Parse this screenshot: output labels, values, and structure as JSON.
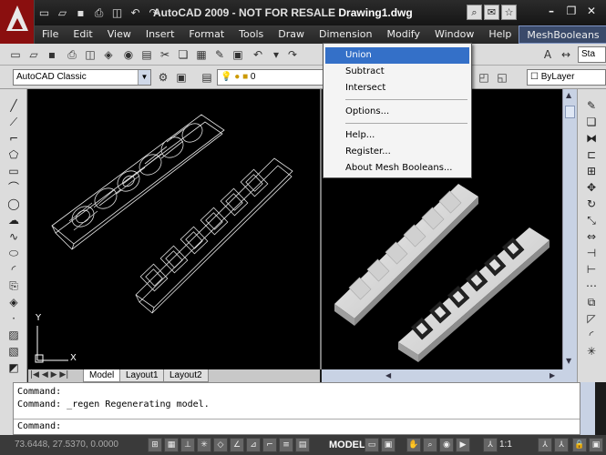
{
  "window": {
    "title_app": "AutoCAD 2009 - NOT FOR RESALE",
    "title_doc": "Drawing1.dwg"
  },
  "menubar": {
    "items": [
      "File",
      "Edit",
      "View",
      "Insert",
      "Format",
      "Tools",
      "Draw",
      "Dimension",
      "Modify",
      "Window",
      "Help",
      "MeshBooleans"
    ]
  },
  "workspace_combo": "AutoCAD Classic",
  "layer_combo": "0",
  "linetype_combo": "ByLayer",
  "dropdown": {
    "items": [
      "Union",
      "Subtract",
      "Intersect",
      "Options...",
      "Help...",
      "Register...",
      "About Mesh Booleans..."
    ],
    "highlighted": "Union"
  },
  "tabs": [
    "Model",
    "Layout1",
    "Layout2"
  ],
  "command": {
    "lines": [
      "Command:",
      "Command: _regen Regenerating model."
    ],
    "prompt": "Command:"
  },
  "status": {
    "coords": "73.6448, 27.5370, 0.0000",
    "model": "MODEL",
    "scale": "1:1"
  },
  "ucs": {
    "y": "Y",
    "x": "X"
  },
  "colors": {
    "highlight": "#3470c8",
    "titlebar": "#1b1b1b",
    "viewport": "#000000"
  }
}
